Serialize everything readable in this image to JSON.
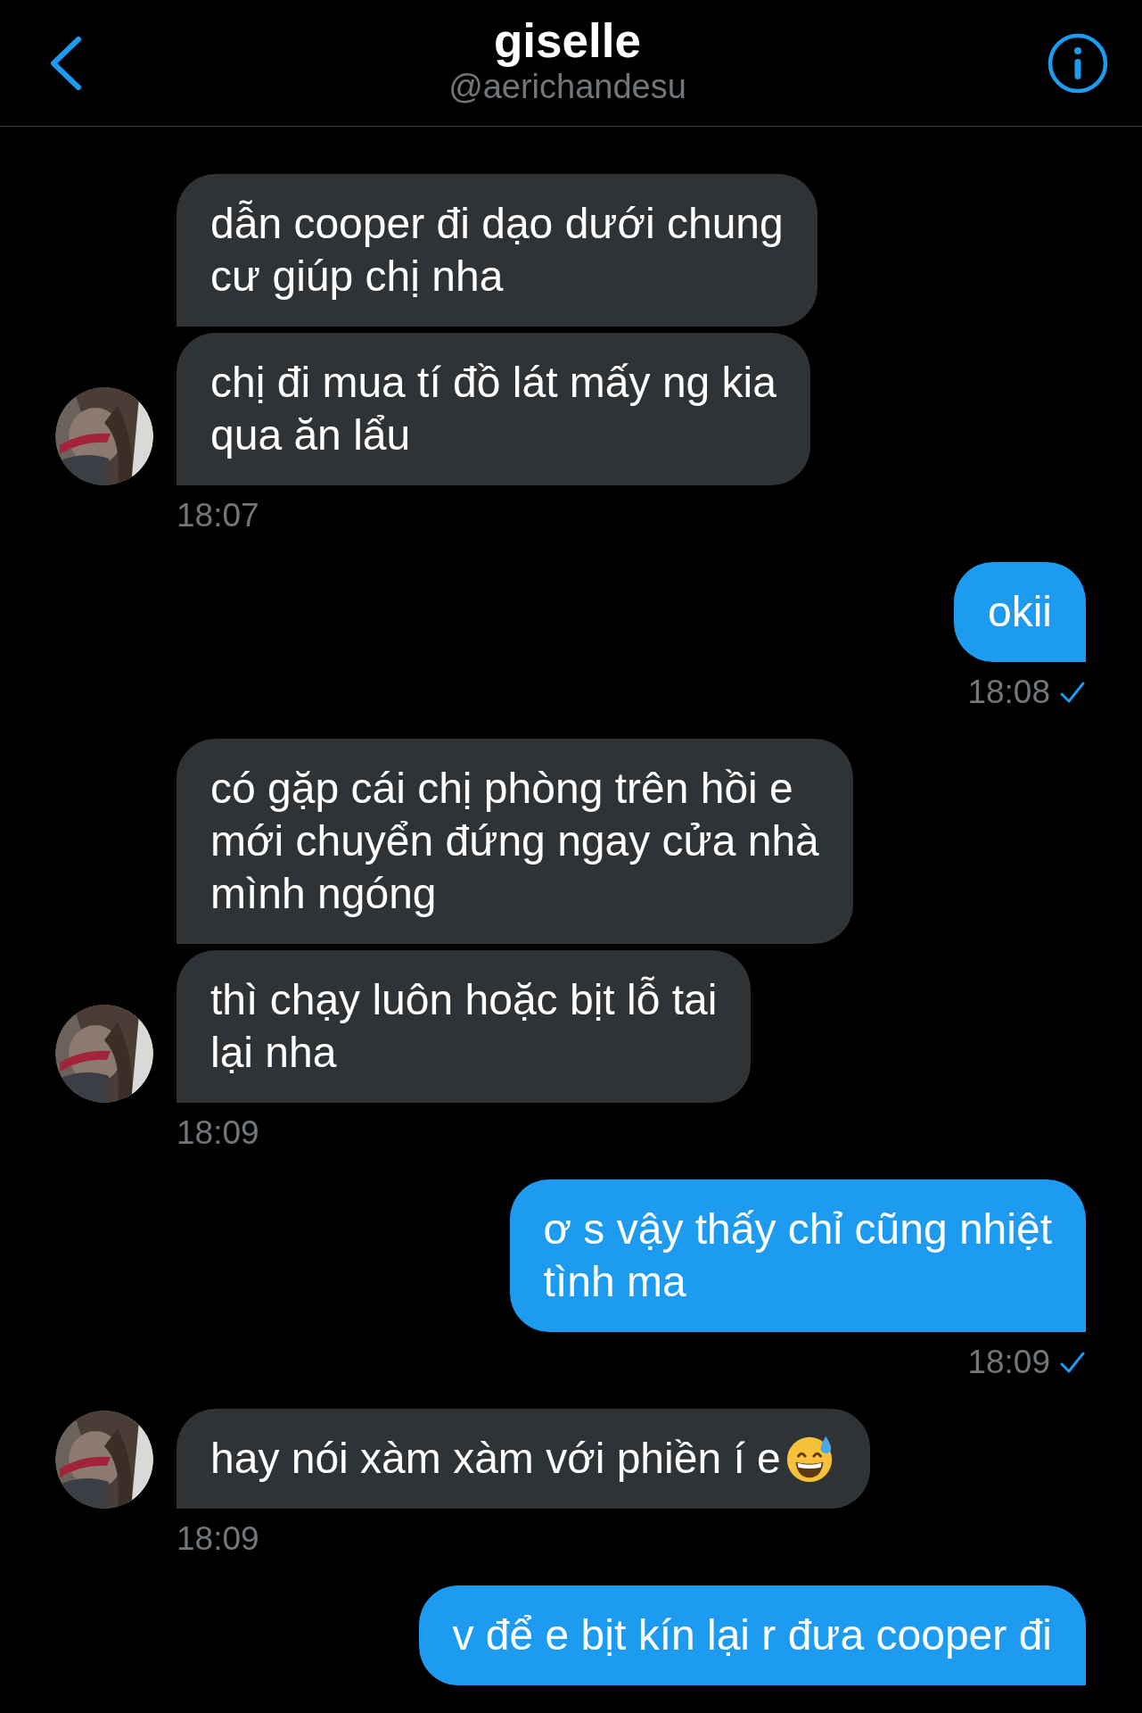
{
  "header": {
    "name": "giselle",
    "handle": "@aerichandesu"
  },
  "groups": [
    {
      "kind": "incoming",
      "bubbles": [
        {
          "lines": [
            "dẫn cooper đi dạo dưới chung",
            "cư giúp chị nha"
          ]
        },
        {
          "lines": [
            "chị đi mua tí đồ lát mấy ng kia",
            "qua ăn lẩu"
          ]
        }
      ],
      "time": "18:07"
    },
    {
      "kind": "outgoing",
      "bubbles": [
        {
          "lines": [
            "okii"
          ]
        }
      ],
      "time": "18:08",
      "seen": true
    },
    {
      "kind": "incoming",
      "bubbles": [
        {
          "lines": [
            "có gặp cái chị phòng trên hồi e",
            "mới chuyển đứng ngay cửa nhà",
            "mình ngóng"
          ]
        },
        {
          "lines": [
            "thì chạy luôn hoặc bịt lỗ tai",
            "lại nha"
          ]
        }
      ],
      "time": "18:09"
    },
    {
      "kind": "outgoing",
      "bubbles": [
        {
          "lines": [
            "ơ s vậy thấy chỉ cũng nhiệt",
            "tình ma"
          ]
        }
      ],
      "time": "18:09",
      "seen": true
    },
    {
      "kind": "incoming",
      "bubbles": [
        {
          "lines": [
            "hay nói xàm xàm với phiền í e"
          ],
          "emoji": true
        }
      ],
      "time": "18:09"
    },
    {
      "kind": "outgoing",
      "bubbles": [
        {
          "lines": [
            "v để e bịt kín lại r đưa cooper đi"
          ]
        }
      ]
    }
  ]
}
